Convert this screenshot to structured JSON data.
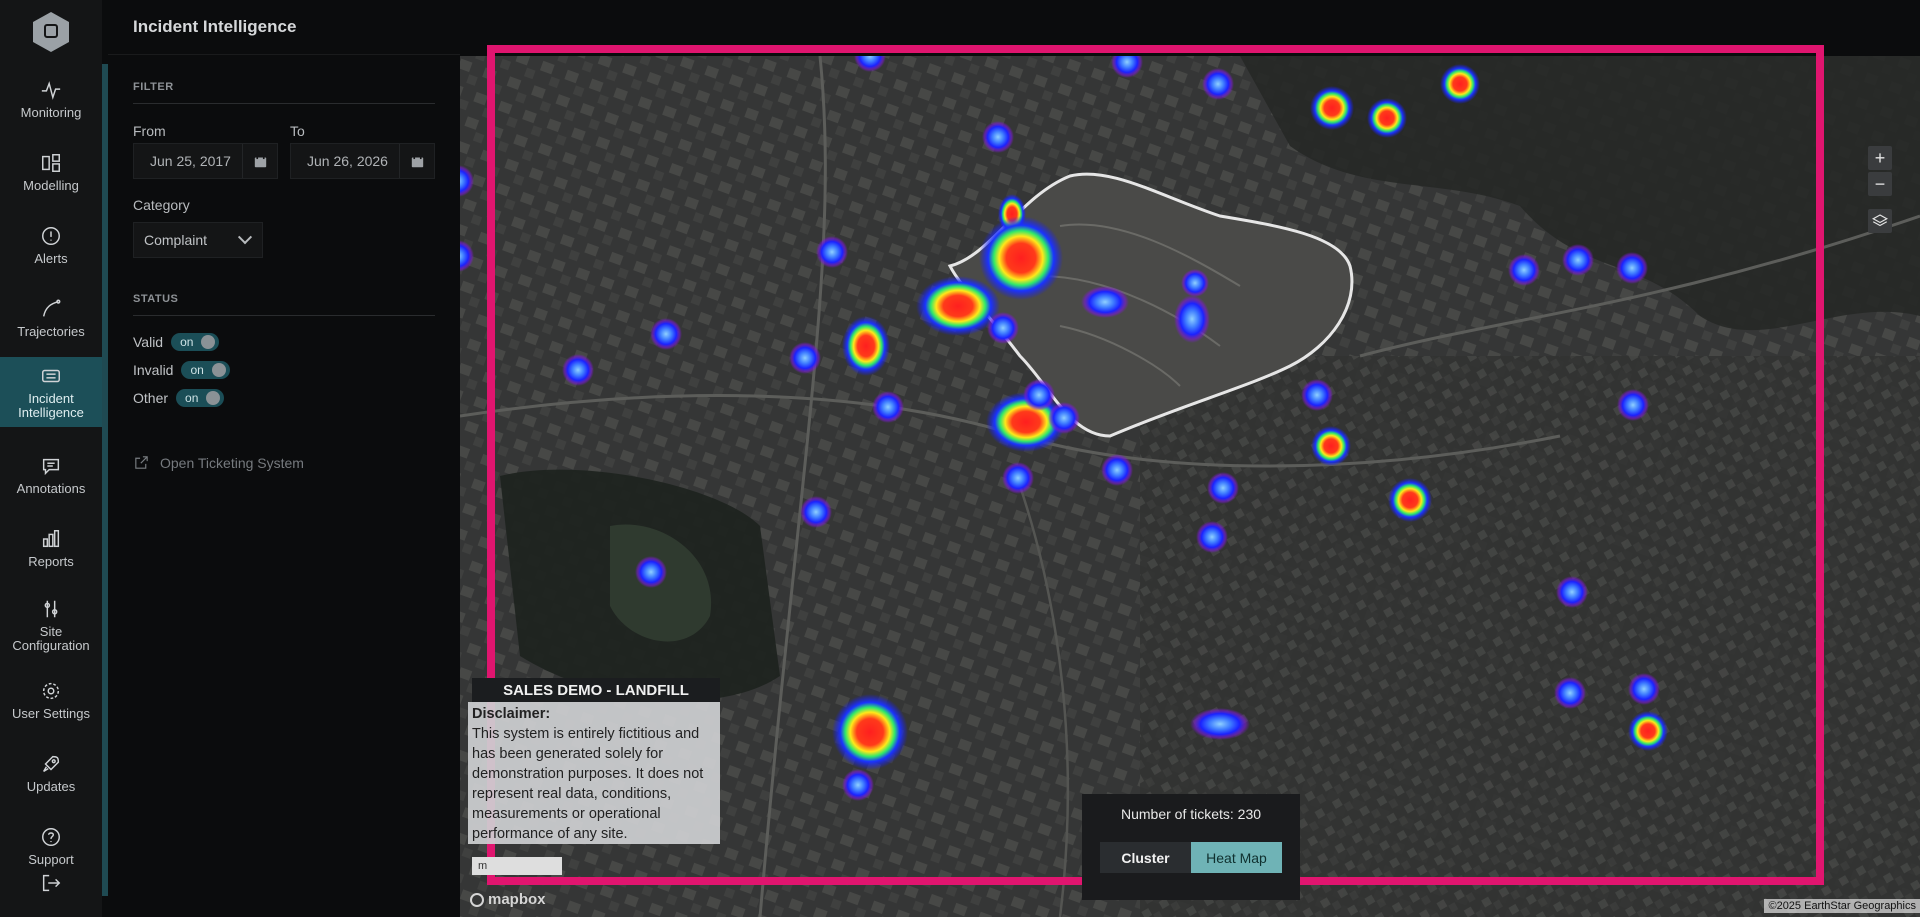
{
  "app": {
    "title": "Incident Intelligence"
  },
  "nav": {
    "items": [
      {
        "label": "Monitoring",
        "icon": "pulse-icon"
      },
      {
        "label": "Modelling",
        "icon": "modelling-icon"
      },
      {
        "label": "Alerts",
        "icon": "alert-icon"
      },
      {
        "label": "Trajectories",
        "icon": "trajectory-icon"
      },
      {
        "label": "Incident Intelligence",
        "icon": "ticket-icon",
        "active": true
      },
      {
        "label": "Annotations",
        "icon": "comment-icon"
      },
      {
        "label": "Reports",
        "icon": "bar-chart-icon"
      },
      {
        "label": "Site Configuration",
        "icon": "sliders-icon"
      },
      {
        "label": "User Settings",
        "icon": "gear-icon"
      },
      {
        "label": "Updates",
        "icon": "rocket-icon"
      },
      {
        "label": "Support",
        "icon": "help-icon"
      }
    ]
  },
  "filter": {
    "section_label": "FILTER",
    "from_label": "From",
    "to_label": "To",
    "from_value": "Jun 25, 2017",
    "to_value": "Jun 26, 2026",
    "category_label": "Category",
    "category_value": "Complaint"
  },
  "status": {
    "section_label": "STATUS",
    "rows": [
      {
        "label": "Valid",
        "toggle": "on"
      },
      {
        "label": "Invalid",
        "toggle": "on"
      },
      {
        "label": "Other",
        "toggle": "on"
      }
    ]
  },
  "ticket_link": "Open Ticketing System",
  "map": {
    "zoom_in": "+",
    "zoom_out": "−",
    "demo_title": "SALES DEMO - LANDFILL",
    "disclaimer_title": "Disclaimer:",
    "disclaimer_text": "This system is entirely fictitious and has been generated solely for demonstration purposes. It does not represent real data, conditions, measurements or operational performance of any site.",
    "scale_label": "m",
    "brand": "mapbox",
    "attribution": "©2025 EarthStar Geographics",
    "ticket_count_text": "Number of tickets: 230",
    "mode_cluster": "Cluster",
    "mode_heatmap": "Heat Map",
    "active_mode": "Heat Map"
  },
  "colors": {
    "accent": "#1c4f58",
    "highlight": "#e0156f",
    "heat_high": "#ff1f1f",
    "heat_low": "#1a33ff"
  }
}
